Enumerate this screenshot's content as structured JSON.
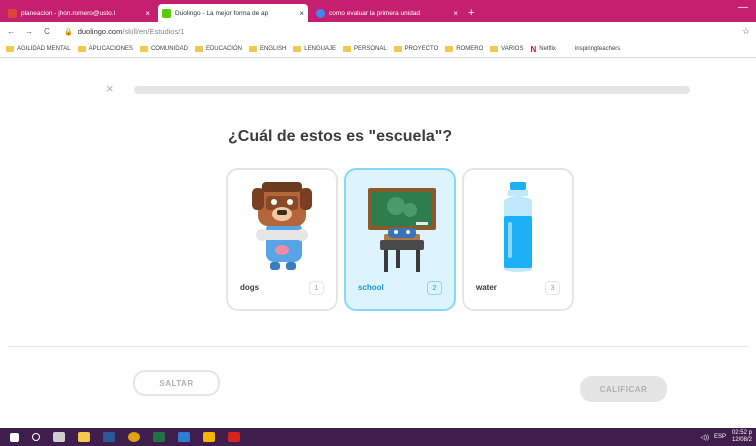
{
  "browser": {
    "tabs": [
      {
        "title": "planeacion - jhon.romero@usto.l",
        "icon_color": "#db4437",
        "active": false
      },
      {
        "title": "Duolingo - La mejor forma de ap",
        "icon_color": "#58cc02",
        "active": true
      },
      {
        "title": "como evaluar la primera unidad",
        "icon_color": "#4285f4",
        "active": false
      }
    ],
    "new_tab": "+",
    "minimize": "—",
    "close_glyph": "×",
    "nav": {
      "back": "←",
      "forward": "→",
      "reload": "C"
    },
    "url_host": "duolingo.com",
    "url_path": "/skill/en/Estudios/1",
    "star": "☆",
    "bookmarks": [
      "AGILIDAD MENTAL",
      "APLICACIONES",
      "COMUNIDAD",
      "EDUCACIÓN",
      "ENGLISH",
      "LENGUAJE",
      "PERSONAL",
      "PROYECTO",
      "ROMERO",
      "VARIOS",
      "Netflix",
      "inspiringteachers"
    ]
  },
  "lesson": {
    "close": "×",
    "progress": 0.0,
    "prompt": "¿Cuál de estos es \"escuela\"?",
    "choices": [
      {
        "label": "dogs",
        "number": "1",
        "icon": "dog-illustration-icon",
        "selected": false
      },
      {
        "label": "school",
        "number": "2",
        "icon": "school-illustration-icon",
        "selected": true
      },
      {
        "label": "water",
        "number": "3",
        "icon": "water-bottle-icon",
        "selected": false
      }
    ],
    "skip_label": "SALTAR",
    "check_label": "CALIFICAR"
  },
  "taskbar": {
    "lang": "ESP",
    "time": "02:52 p",
    "date": "12/08/2"
  },
  "colors": {
    "accent": "#1899d6",
    "selected_bg": "#ddf4ff",
    "tab_bar": "#c4206f",
    "taskbar": "#3f1d4c"
  }
}
